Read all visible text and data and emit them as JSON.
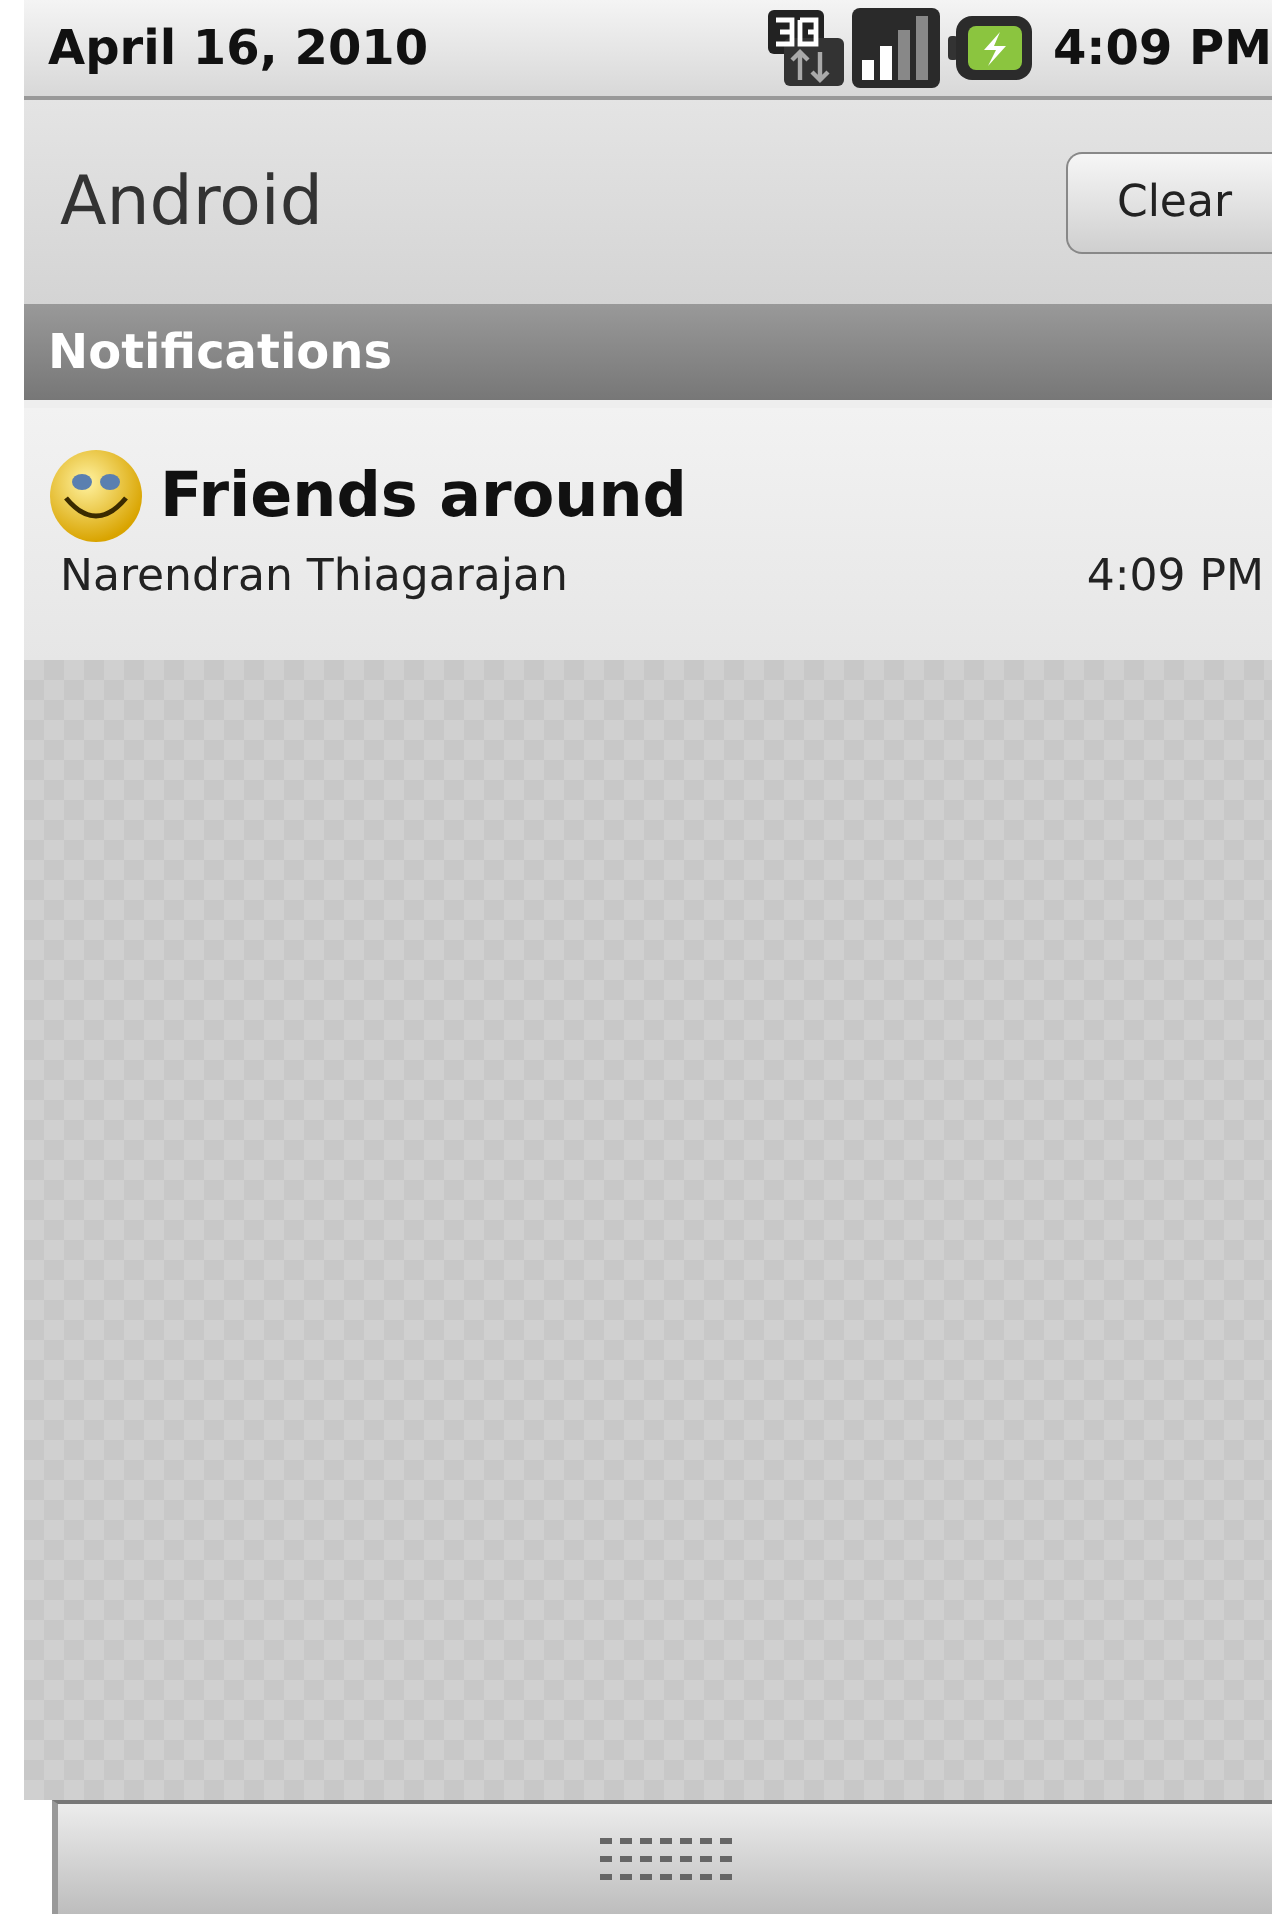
{
  "status_bar": {
    "date": "April 16, 2010",
    "time": "4:09 PM"
  },
  "title_bar": {
    "title": "Android",
    "button": "Clear"
  },
  "section": {
    "title": "Notifications"
  },
  "notifications": [
    {
      "title": "Friends around",
      "sender": "Narendran Thiagarajan",
      "time": "4:09 PM"
    }
  ]
}
